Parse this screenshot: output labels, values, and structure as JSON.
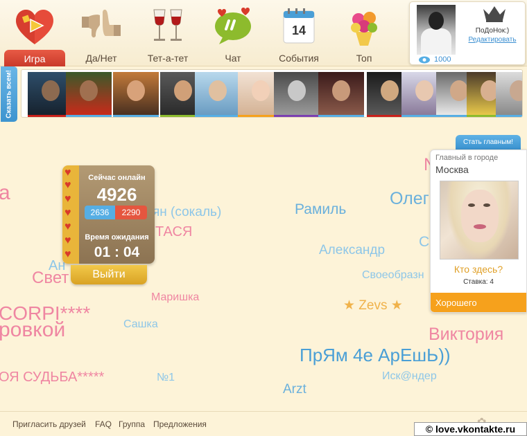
{
  "nav": {
    "items": [
      {
        "label": "Игра",
        "active": true
      },
      {
        "label": "Да/Нет"
      },
      {
        "label": "Тет-а-тет"
      },
      {
        "label": "Чат"
      },
      {
        "label": "События",
        "calendar_day": "14"
      },
      {
        "label": "Топ"
      }
    ]
  },
  "profile": {
    "name": "ПоДоНок:)",
    "edit_label": "Редактировать",
    "views": "1000"
  },
  "sidebar": {
    "say_all": "Сказать всем!"
  },
  "strip": {
    "bar_colors": [
      "#c8201a",
      "#56aee4",
      "#56aee4",
      "#8dbb2d",
      "#56aee4",
      "#f6a11c",
      "#7b3fb1",
      "#56aee4",
      "#c8201a",
      "#56aee4",
      "#56aee4",
      "#8dbb2d",
      "#56aee4"
    ]
  },
  "cloud": [
    {
      "text": "а",
      "color": "#ef86a2",
      "size": 30
    },
    {
      "text": "ян (сокаль)",
      "color": "#8dc6e8",
      "size": 19
    },
    {
      "text": "ТАСЯ",
      "color": "#ef86a2",
      "size": 20
    },
    {
      "text": "Ан",
      "color": "#8dc6e8",
      "size": 20
    },
    {
      "text": "Свет",
      "color": "#ef86a2",
      "size": 24
    },
    {
      "text": "Маришка",
      "color": "#ef86a2",
      "size": 16
    },
    {
      "text": "CORPI****",
      "color": "#ef86a2",
      "size": 28
    },
    {
      "text": "ровкой",
      "color": "#ef86a2",
      "size": 30
    },
    {
      "text": "Сашка",
      "color": "#8dc6e8",
      "size": 16
    },
    {
      "text": "ОЯ СУДЬБА*****",
      "color": "#ef86a2",
      "size": 20
    },
    {
      "text": "№1",
      "color": "#8dc6e8",
      "size": 16
    },
    {
      "text": "Рамиль",
      "color": "#6ab0dc",
      "size": 21
    },
    {
      "text": "Олег",
      "color": "#6ab0dc",
      "size": 25
    },
    {
      "text": "Александр",
      "color": "#8dc6e8",
      "size": 19
    },
    {
      "text": "С",
      "color": "#8dc6e8",
      "size": 21
    },
    {
      "text": "Своеобразн",
      "color": "#8dc6e8",
      "size": 16
    },
    {
      "text": "★ Zevs ★",
      "color": "#f0b24a",
      "size": 19
    },
    {
      "text": "N",
      "color": "#ef86a2",
      "size": 25
    },
    {
      "text": "Виктория",
      "color": "#ef86a2",
      "size": 25
    },
    {
      "text": "ПрЯм 4е АрЕшЬ))",
      "color": "#4a9fd6",
      "size": 26
    },
    {
      "text": "Иск@ндер",
      "color": "#8dc6e8",
      "size": 16
    },
    {
      "text": "Arzt",
      "color": "#6ab0dc",
      "size": 19
    }
  ],
  "online": {
    "title": "Сейчас онлайн",
    "count": "4926",
    "blue_count": "2636",
    "red_count": "2290",
    "wait_label": "Время ожидания",
    "wait_time": "01 : 04",
    "exit_label": "Выйти"
  },
  "city": {
    "make_main": "Стать главным!",
    "label": "Главный в городе",
    "city": "Москва",
    "who_here": "Кто здесь?",
    "bid": "Ставка: 4",
    "status": "Хорошего"
  },
  "footer": {
    "links": [
      "Пригласить друзей",
      "FAQ",
      "Группа",
      "Предложения"
    ],
    "watermark": "© love.vkontakte.ru"
  }
}
